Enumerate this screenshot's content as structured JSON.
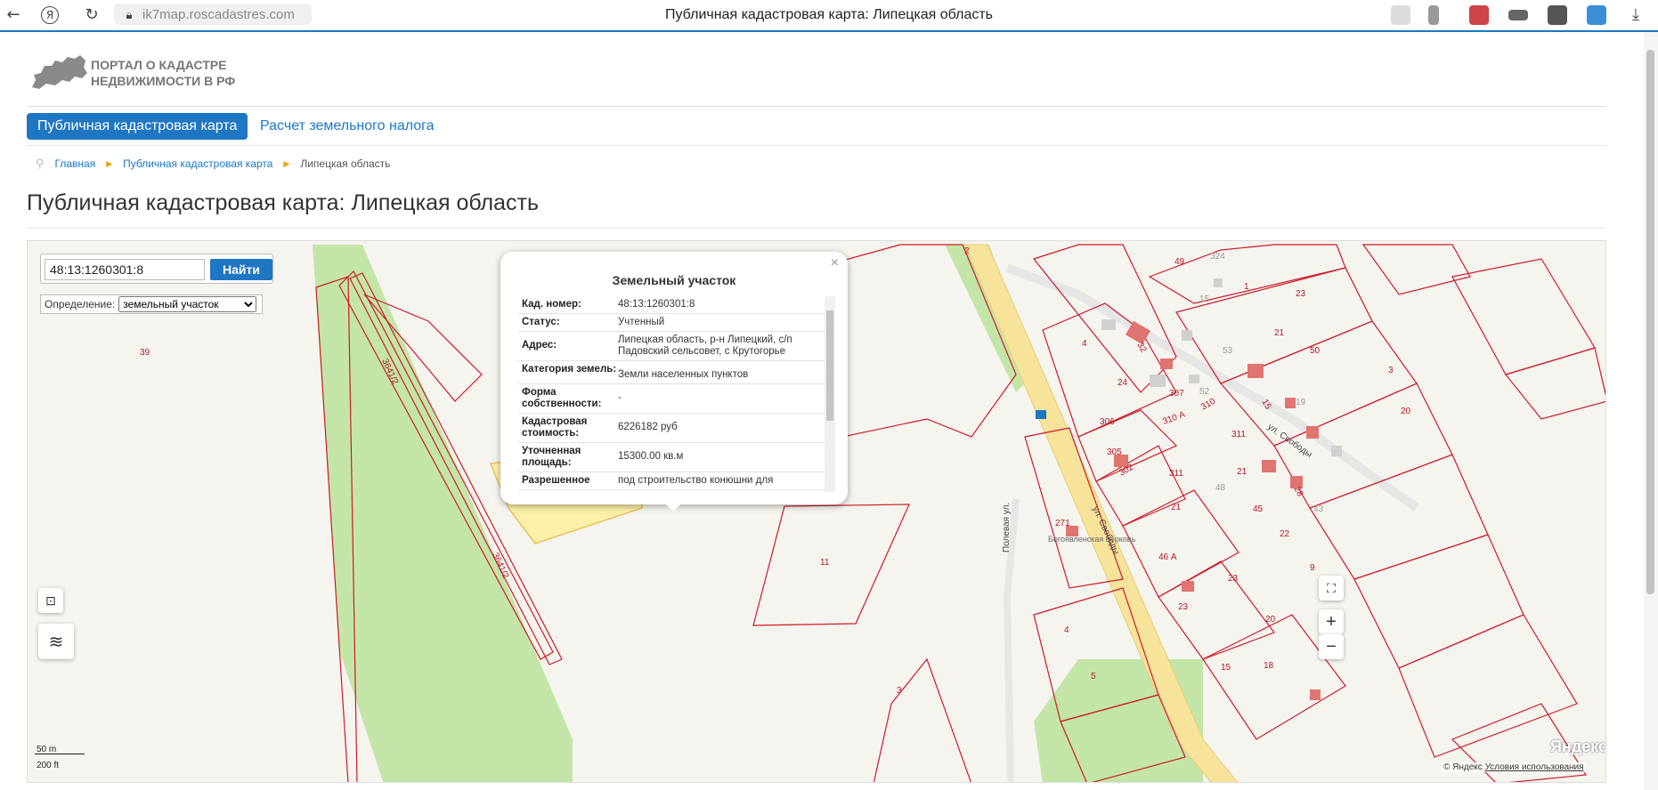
{
  "browser": {
    "url": "ik7map.roscadastres.com",
    "tab_title": "Публичная кадастровая карта: Липецкая область",
    "yandex_icon": "Я"
  },
  "portal": {
    "logo_text": "Портал о кадастре недвижимости в РФ"
  },
  "nav": {
    "active": "Публичная кадастровая карта",
    "tax": "Расчет земельного налога"
  },
  "breadcrumb": {
    "home": "Главная",
    "map": "Публичная кадастровая карта",
    "current": "Липецкая область"
  },
  "page_title": "Публичная кадастровая карта: Липецкая область",
  "search": {
    "value": "48:13:1260301:8",
    "button": "Найти",
    "definition_label": "Определение:",
    "definition_value": "земельный участок"
  },
  "popup": {
    "title": "Земельный участок",
    "close": "×",
    "rows": [
      {
        "key": "Кад. номер:",
        "value": "48:13:1260301:8"
      },
      {
        "key": "Статус:",
        "value": "Учтенный"
      },
      {
        "key": "Адрес:",
        "value": "Липецкая область, р-н Липецкий, с/п Падовский сельсовет, с Крутогорье"
      },
      {
        "key": "Категория земель:",
        "value": "Земли населенных пунктов"
      },
      {
        "key": "Форма собственности:",
        "value": "-"
      },
      {
        "key": "Кадастровая стоимость:",
        "value": "6226182 руб"
      },
      {
        "key": "Уточненная площадь:",
        "value": "15300.00 кв.м"
      },
      {
        "key": "Разрешенное",
        "value": "под строительство конюшни для"
      }
    ]
  },
  "map_labels": {
    "p39": "39",
    "road1": "3641/2",
    "road2": "3641/2",
    "p11": "11",
    "p8": "8",
    "p2": "2",
    "p49": "49",
    "p324": "324",
    "p1": "1",
    "p15": "15",
    "p23a": "23",
    "p4a": "4",
    "p32": "32",
    "p53": "53",
    "p21a": "21",
    "p50": "50",
    "p3": "3",
    "p24": "24",
    "p307": "307",
    "p52": "52",
    "p310": "310",
    "p15b": "15",
    "p19": "19",
    "p20": "20",
    "p306": "306",
    "p310a": "310 А",
    "p311a": "311",
    "p305": "305",
    "p302": "302",
    "p311": "311",
    "p21b": "21",
    "p48": "48",
    "p28": "28",
    "p43": "43",
    "p21c": "21",
    "p45": "45",
    "p22": "22",
    "p46": "46 А",
    "p23b": "23",
    "p23c": "23",
    "p271": "271",
    "church": "Богоявленская церковь",
    "p4b": "4",
    "p5": "5",
    "p3b": "3",
    "p15c": "15",
    "p18": "18",
    "p20b": "20",
    "p9": "9",
    "street_svobody": "ул. Свободы",
    "street_svobody2": "ул. Свободы",
    "street_polevaya": "Полевая ул.",
    "road_sign": "М"
  },
  "scale": {
    "m": "50 m",
    "ft": "200 ft"
  },
  "attribution": {
    "yandex": "Яндекс",
    "copy": "© Яндекс",
    "terms": "Условия использования"
  },
  "map_controls": {
    "zoom_in": "+",
    "zoom_out": "−"
  },
  "colors": {
    "accent": "#1f77c4",
    "parcel_line": "#cc1a2a",
    "selected_parcel": "#fcf0a8",
    "green": "#c3e6a8",
    "road": "#f7e39a"
  }
}
